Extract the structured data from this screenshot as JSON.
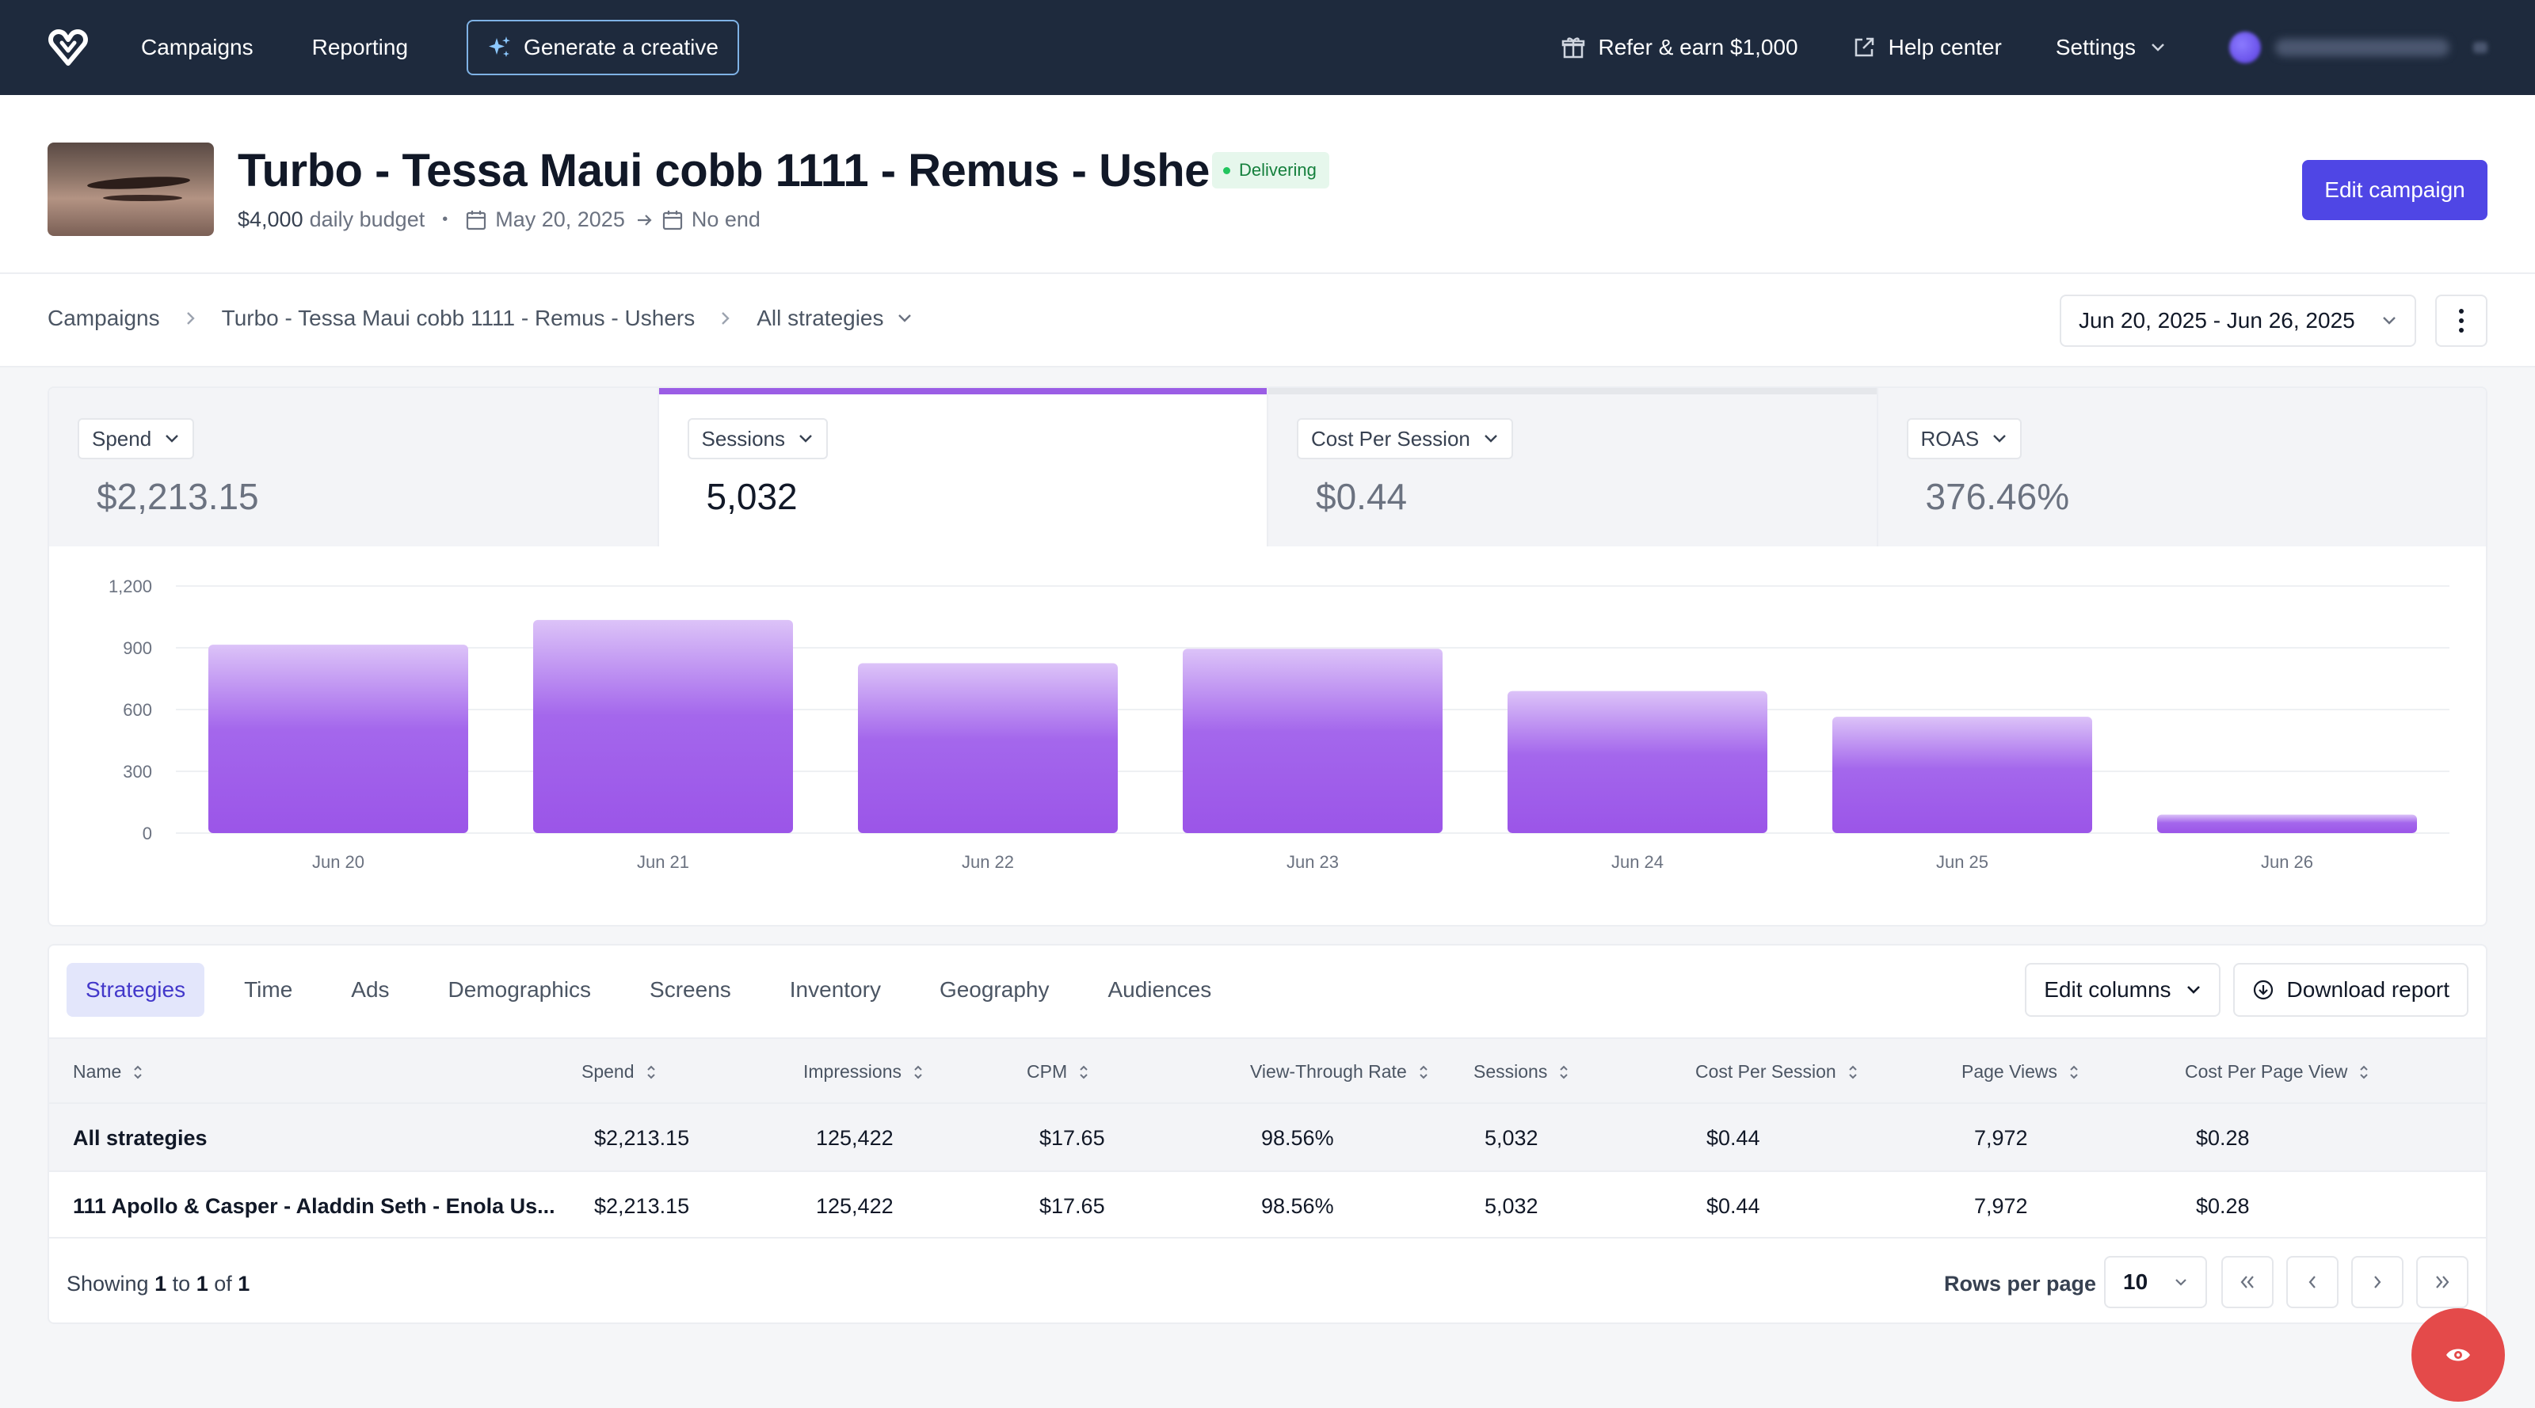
{
  "nav": {
    "links": [
      "Campaigns",
      "Reporting"
    ],
    "generate_label": "Generate a creative",
    "refer_label": "Refer & earn $1,000",
    "help_label": "Help center",
    "settings_label": "Settings"
  },
  "campaign": {
    "title": "Turbo - Tessa Maui cobb 1111 - Remus - Ushers",
    "status": "Delivering",
    "budget_amount": "$4,000",
    "budget_suffix": "daily budget",
    "start_date": "May 20, 2025",
    "end_date": "No end",
    "edit_label": "Edit campaign"
  },
  "breadcrumb": {
    "items": [
      "Campaigns",
      "Turbo - Tessa Maui cobb 1111 - Remus - Ushers",
      "All strategies"
    ],
    "date_range": "Jun 20, 2025 - Jun 26, 2025"
  },
  "metrics": [
    {
      "label": "Spend",
      "value": "$2,213.15"
    },
    {
      "label": "Sessions",
      "value": "5,032"
    },
    {
      "label": "Cost Per Session",
      "value": "$0.44"
    },
    {
      "label": "ROAS",
      "value": "376.46%"
    }
  ],
  "chart_data": {
    "type": "bar",
    "categories": [
      "Jun 20",
      "Jun 21",
      "Jun 22",
      "Jun 23",
      "Jun 24",
      "Jun 25",
      "Jun 26"
    ],
    "values": [
      915,
      1035,
      825,
      895,
      690,
      565,
      90
    ],
    "yticks": [
      0,
      300,
      600,
      900,
      1200
    ],
    "ylim": [
      0,
      1200
    ],
    "grid": true,
    "bar_color_top": "#dcc3f8",
    "bar_color_bottom": "#9b55e8"
  },
  "table": {
    "tabs": [
      "Strategies",
      "Time",
      "Ads",
      "Demographics",
      "Screens",
      "Inventory",
      "Geography",
      "Audiences"
    ],
    "edit_columns_label": "Edit columns",
    "download_label": "Download report",
    "columns": [
      "Name",
      "Spend",
      "Impressions",
      "CPM",
      "View-Through Rate",
      "Sessions",
      "Cost Per Session",
      "Page Views",
      "Cost Per Page View"
    ],
    "total_row": [
      "All strategies",
      "$2,213.15",
      "125,422",
      "$17.65",
      "98.56%",
      "5,032",
      "$0.44",
      "7,972",
      "$0.28"
    ],
    "rows": [
      [
        "111 Apollo & Casper - Aladdin Seth - Enola Us...",
        "$2,213.15",
        "125,422",
        "$17.65",
        "98.56%",
        "5,032",
        "$0.44",
        "7,972",
        "$0.28"
      ]
    ],
    "showing_prefix": "Showing",
    "showing_from": "1",
    "showing_to_word": "to",
    "showing_to": "1",
    "showing_of_word": "of",
    "showing_total": "1",
    "rows_per_page_label": "Rows per page",
    "rows_per_page": "10"
  }
}
